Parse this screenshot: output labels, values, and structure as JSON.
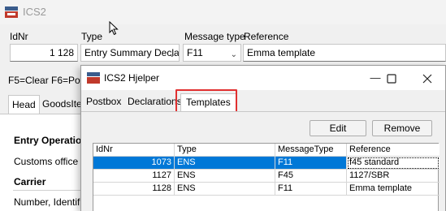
{
  "app": {
    "title": "ICS2"
  },
  "header": {
    "idnr": {
      "label": "IdNr",
      "value": "1 128"
    },
    "type": {
      "label": "Type",
      "value": "Entry Summary Decla"
    },
    "message_type": {
      "label": "Message type",
      "value": "F11"
    },
    "reference": {
      "label": "Reference",
      "value": "Emma template"
    }
  },
  "hint": "F5=Clear  F6=Po",
  "main_tabs": [
    "Head",
    "GoodsIte"
  ],
  "sections": {
    "entry_operation": "Entry Operatio",
    "customs_office": "Customs office fi",
    "carrier": "Carrier",
    "number_identification": "Number, Identific"
  },
  "dialog": {
    "title": "ICS2 Hjelper",
    "tabs": [
      "Postbox",
      "Declarations",
      "Templates"
    ],
    "active_tab": "Templates",
    "buttons": {
      "edit": "Edit",
      "remove": "Remove"
    },
    "table": {
      "columns": [
        "IdNr",
        "Type",
        "MessageType",
        "Reference"
      ],
      "rows": [
        {
          "idnr": "1073",
          "type": "ENS",
          "message_type": "F11",
          "reference": "f45 standard",
          "selected": true
        },
        {
          "idnr": "1127",
          "type": "ENS",
          "message_type": "F45",
          "reference": "1127/SBR",
          "selected": false
        },
        {
          "idnr": "1128",
          "type": "ENS",
          "message_type": "F11",
          "reference": "Emma template",
          "selected": false
        }
      ]
    }
  }
}
